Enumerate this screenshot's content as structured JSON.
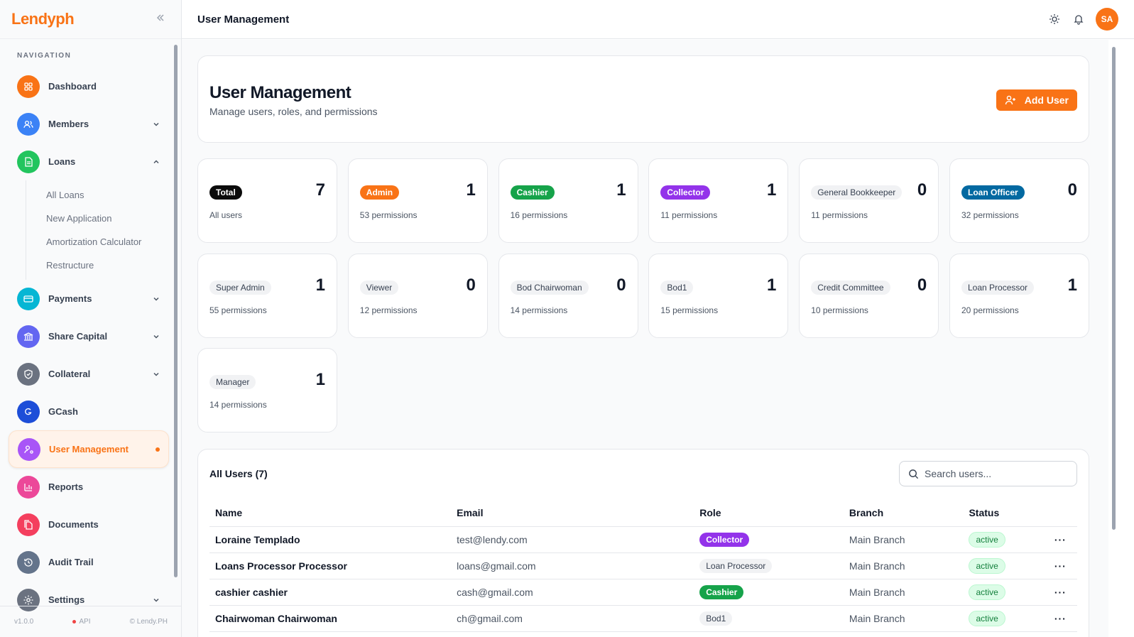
{
  "app": {
    "logo": "Lendyph"
  },
  "header": {
    "title": "User Management",
    "avatar_initials": "SA"
  },
  "sidebar": {
    "heading": "NAVIGATION",
    "items": [
      {
        "label": "Dashboard",
        "icon": "dashboard-icon",
        "color": "#f97316",
        "chevron": ""
      },
      {
        "label": "Members",
        "icon": "users-icon",
        "color": "#3b82f6",
        "chevron": "down"
      },
      {
        "label": "Loans",
        "icon": "document-icon",
        "color": "#22c55e",
        "chevron": "up"
      },
      {
        "label": "Payments",
        "icon": "credit-card-icon",
        "color": "#06b6d4",
        "chevron": "down"
      },
      {
        "label": "Share Capital",
        "icon": "bank-icon",
        "color": "#6366f1",
        "chevron": "down"
      },
      {
        "label": "Collateral",
        "icon": "shield-icon",
        "color": "#6b7280",
        "chevron": "down"
      },
      {
        "label": "GCash",
        "icon": "gcash-icon",
        "color": "#1d4ed8",
        "chevron": ""
      },
      {
        "label": "User Management",
        "icon": "user-cog-icon",
        "color": "#a855f7",
        "chevron": "",
        "active": true
      },
      {
        "label": "Reports",
        "icon": "chart-icon",
        "color": "#ec4899",
        "chevron": ""
      },
      {
        "label": "Documents",
        "icon": "files-icon",
        "color": "#f43f5e",
        "chevron": ""
      },
      {
        "label": "Audit Trail",
        "icon": "history-icon",
        "color": "#64748b",
        "chevron": ""
      },
      {
        "label": "Settings",
        "icon": "gear-icon",
        "color": "#6b7280",
        "chevron": "down"
      }
    ],
    "loans_sub": [
      "All Loans",
      "New Application",
      "Amortization Calculator",
      "Restructure"
    ],
    "footer": {
      "version": "v1.0.0",
      "api": "API",
      "copyright": "© Lendy.PH"
    }
  },
  "page": {
    "title": "User Management",
    "subtitle": "Manage users, roles, and permissions",
    "add_button": "Add User"
  },
  "stats": [
    {
      "label": "Total",
      "count": "7",
      "caption": "All users",
      "style": "dark"
    },
    {
      "label": "Admin",
      "count": "1",
      "caption": "53 permissions",
      "style": "orange"
    },
    {
      "label": "Cashier",
      "count": "1",
      "caption": "16 permissions",
      "style": "green"
    },
    {
      "label": "Collector",
      "count": "1",
      "caption": "11 permissions",
      "style": "purple"
    },
    {
      "label": "General Bookkeeper",
      "count": "0",
      "caption": "11 permissions",
      "style": "gray"
    },
    {
      "label": "Loan Officer",
      "count": "0",
      "caption": "32 permissions",
      "style": "blue"
    },
    {
      "label": "Super Admin",
      "count": "1",
      "caption": "55 permissions",
      "style": "gray"
    },
    {
      "label": "Viewer",
      "count": "0",
      "caption": "12 permissions",
      "style": "gray"
    },
    {
      "label": "Bod Chairwoman",
      "count": "0",
      "caption": "14 permissions",
      "style": "gray"
    },
    {
      "label": "Bod1",
      "count": "1",
      "caption": "15 permissions",
      "style": "gray"
    },
    {
      "label": "Credit Committee",
      "count": "0",
      "caption": "10 permissions",
      "style": "gray"
    },
    {
      "label": "Loan Processor",
      "count": "1",
      "caption": "20 permissions",
      "style": "gray"
    },
    {
      "label": "Manager",
      "count": "1",
      "caption": "14 permissions",
      "style": "gray"
    }
  ],
  "users": {
    "title": "All Users (7)",
    "search_placeholder": "Search users...",
    "columns": [
      "Name",
      "Email",
      "Role",
      "Branch",
      "Status"
    ],
    "rows": [
      {
        "name": "Loraine Templado",
        "email": "test@lendy.com",
        "role": "Collector",
        "role_style": "purple",
        "branch": "Main Branch",
        "status": "active"
      },
      {
        "name": "Loans Processor Processor",
        "email": "loans@gmail.com",
        "role": "Loan Processor",
        "role_style": "gray",
        "branch": "Main Branch",
        "status": "active"
      },
      {
        "name": "cashier cashier",
        "email": "cash@gmail.com",
        "role": "Cashier",
        "role_style": "green",
        "branch": "Main Branch",
        "status": "active"
      },
      {
        "name": "Chairwoman Chairwoman",
        "email": "ch@gmail.com",
        "role": "Bod1",
        "role_style": "gray",
        "branch": "Main Branch",
        "status": "active"
      }
    ],
    "row_action": "···"
  }
}
